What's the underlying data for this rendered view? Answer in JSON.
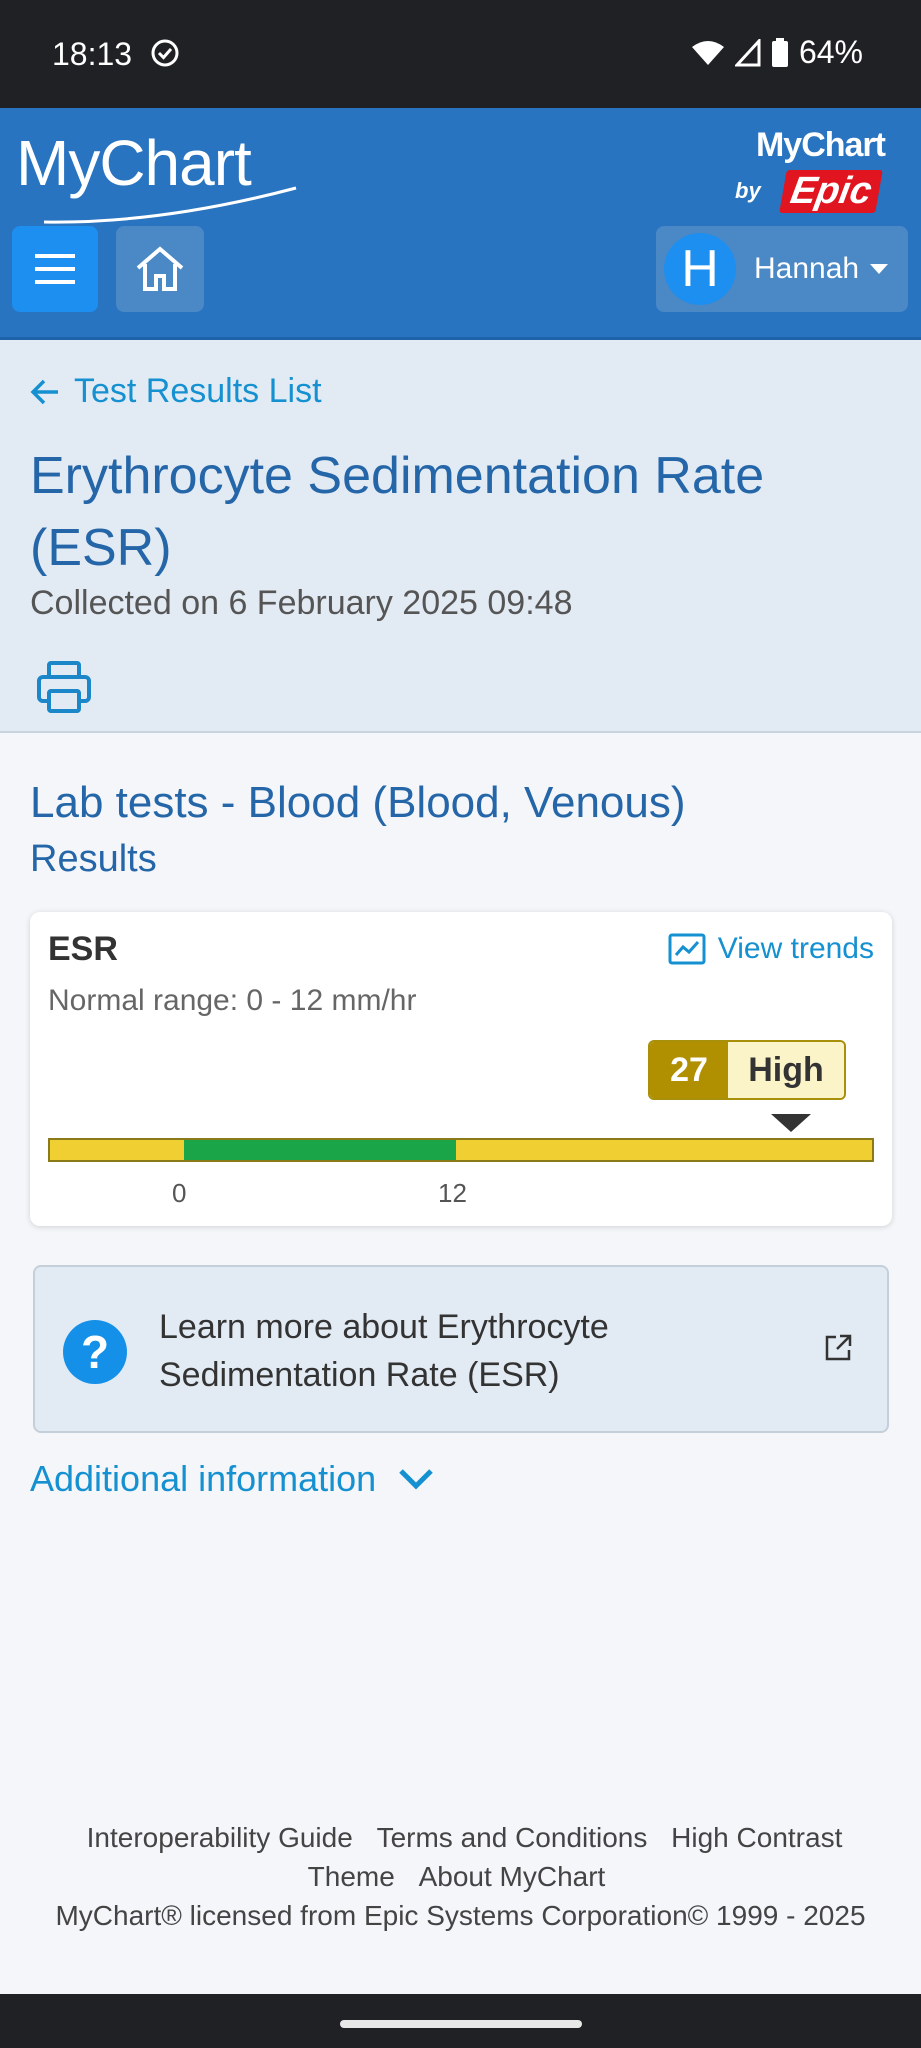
{
  "status_bar": {
    "time": "18:13",
    "battery": "64%"
  },
  "header": {
    "logo_text": "MyChart",
    "brand_mychart": "MyChart",
    "brand_by": "by",
    "brand_epic": "Epic",
    "user_initial": "H",
    "user_name": "Hannah"
  },
  "page": {
    "back_link": "Test Results List",
    "title": "Erythrocyte Sedimentation Rate (ESR)",
    "collected": "Collected on 6 February 2025 09:48"
  },
  "section": {
    "title": "Lab tests - Blood (Blood, Venous)",
    "subtitle": "Results"
  },
  "result": {
    "name": "ESR",
    "view_trends": "View trends",
    "normal_range": "Normal range: 0 - 12 mm/hr",
    "value": "27",
    "flag": "High",
    "range_low": "0",
    "range_high": "12"
  },
  "learn_more": {
    "text": "Learn more about Erythrocyte Sedimentation Rate (ESR)"
  },
  "additional_info": "Additional information",
  "footer": {
    "links": [
      "Interoperability Guide",
      "Terms and Conditions",
      "High Contrast Theme",
      "About MyChart"
    ],
    "license": "MyChart® licensed from Epic Systems Corporation© 1999 - 2025"
  },
  "colors": {
    "header": "#2874c0",
    "title": "#2566a8",
    "link": "#1590d0",
    "abnormal": "#b08f00",
    "normal": "#1aa548",
    "out_of_range": "#f0cf32"
  }
}
